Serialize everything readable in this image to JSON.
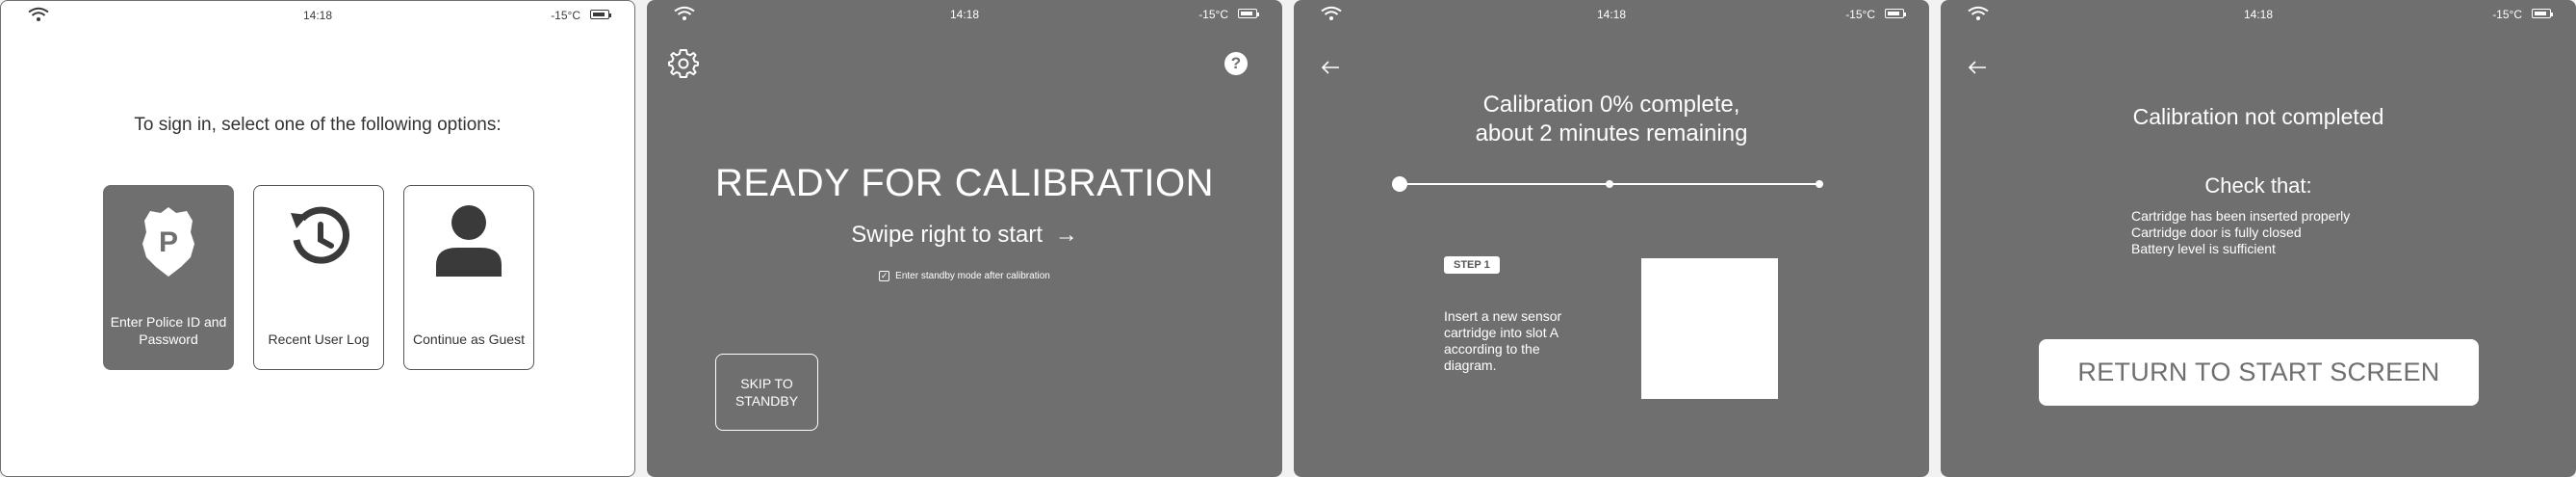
{
  "status": {
    "time": "14:18",
    "temperature": "-15°C"
  },
  "screen_signin": {
    "prompt": "To sign in, select one of the following options:",
    "options": [
      {
        "label": "Enter Police ID and Password",
        "icon": "police-badge-icon"
      },
      {
        "label": "Recent User Log",
        "icon": "history-icon"
      },
      {
        "label": "Continue as Guest",
        "icon": "person-icon"
      }
    ]
  },
  "screen_ready": {
    "title": "READY FOR CALIBRATION",
    "swipe": "Swipe right to start",
    "swipe_arrow": "→",
    "standby_checkbox_mark": "✓",
    "standby_label": "Enter standby mode after calibration",
    "skip_line1": "SKIP TO",
    "skip_line2": "STANDBY",
    "help_glyph": "?"
  },
  "screen_progress": {
    "title_line1": "Calibration 0% complete,",
    "title_line2": "about 2 minutes remaining",
    "progress": 0,
    "step_badge": "STEP 1",
    "step_text": "Insert a new sensor cartridge into slot A according to the diagram."
  },
  "screen_incomplete": {
    "title": "Calibration not completed",
    "check_title": "Check that:",
    "checks": [
      "Cartridge has been inserted properly",
      "Cartridge door is fully closed",
      "Battery level is sufficient"
    ],
    "return_button": "RETURN TO START SCREEN"
  }
}
